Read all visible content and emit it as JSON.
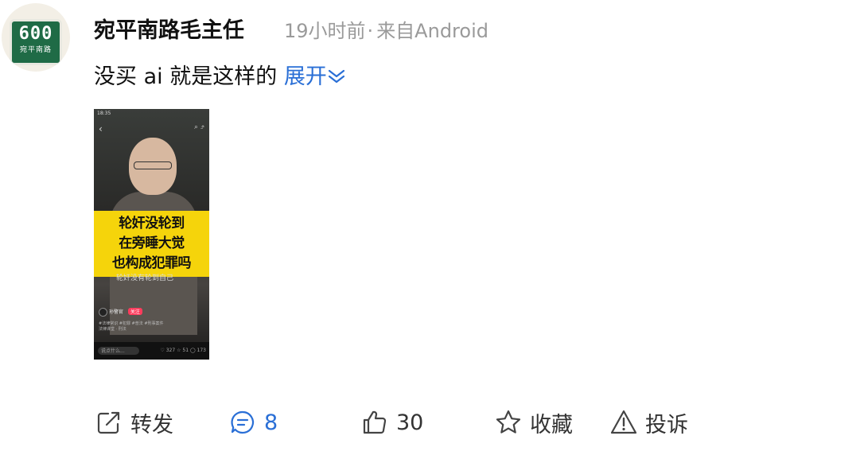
{
  "post": {
    "avatar": {
      "plate_number": "600",
      "plate_street": "宛平南路"
    },
    "username": "宛平南路毛主任",
    "time": "19小时前",
    "separator": "·",
    "source": "来自Android",
    "content": "没买 ai 就是这样的",
    "expand_label": "展开"
  },
  "video_thumbnail": {
    "status_time": "18:35",
    "caption_lines": [
      "轮奸没轮到",
      "在旁睡大觉",
      "也构成犯罪吗"
    ],
    "subtitle": "轮奸没有轮到自己",
    "author": "孙警官",
    "follow_label": "关注",
    "description": "#法律常识 #犯罪 #普法 #刑事案件",
    "tag": "法律课堂 · 刑法",
    "input_placeholder": "说点什么...",
    "stats": {
      "likes": "327",
      "stars": "51",
      "comments": "173"
    }
  },
  "actions": {
    "repost_label": "转发",
    "comment_count": "8",
    "like_count": "30",
    "favorite_label": "收藏",
    "report_label": "投诉"
  },
  "colors": {
    "link_blue": "#2a6fd6",
    "meta_gray": "#9a9a9a",
    "caption_yellow": "#f5d40b"
  }
}
